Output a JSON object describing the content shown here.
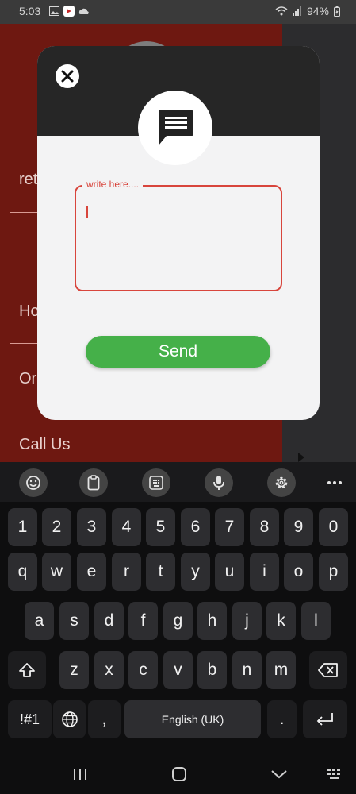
{
  "status_bar": {
    "time": "5:03",
    "battery": "94%"
  },
  "background_app": {
    "items": [
      "ret",
      "Ho",
      "Or",
      "Call Us"
    ]
  },
  "dialog": {
    "legend": "write here....",
    "message_value": "",
    "send_label": "Send"
  },
  "keyboard": {
    "number_row": [
      "1",
      "2",
      "3",
      "4",
      "5",
      "6",
      "7",
      "8",
      "9",
      "0"
    ],
    "row1": [
      "q",
      "w",
      "e",
      "r",
      "t",
      "y",
      "u",
      "i",
      "o",
      "p"
    ],
    "row2": [
      "a",
      "s",
      "d",
      "f",
      "g",
      "h",
      "j",
      "k",
      "l"
    ],
    "row3": [
      "z",
      "x",
      "c",
      "v",
      "b",
      "n",
      "m"
    ],
    "symbols_label": "!#1",
    "comma": ",",
    "space_label": "English (UK)",
    "period": "."
  },
  "colors": {
    "accent_red": "#d8453c",
    "send_green": "#45b049"
  }
}
